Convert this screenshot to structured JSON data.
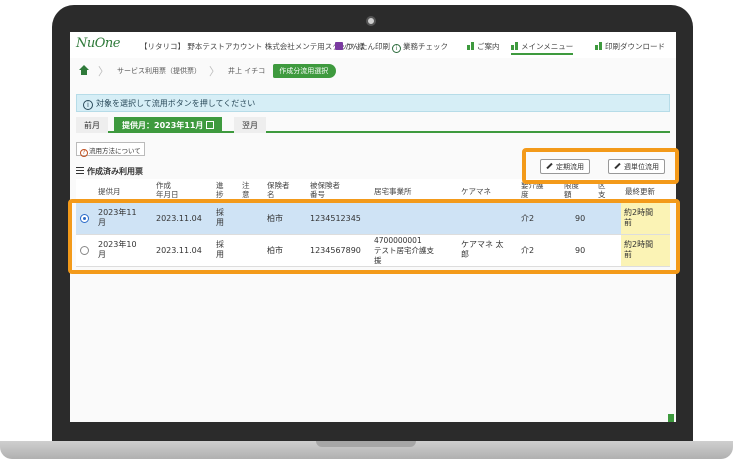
{
  "app": {
    "logo_text": "NuOne",
    "user_info": "【リタリコ】 野本テストアカウント 株式会社メンテ用スタッフ 様",
    "header_links": {
      "print": "かんたん印刷",
      "check": "業務チェック",
      "guide": "ご案内",
      "main_menu": "メインメニュー",
      "download": "印刷ダウンロード"
    }
  },
  "breadcrumb": {
    "item1": "サービス利用票（提供票）",
    "item2": "井上 イチコ",
    "current": "作成分流用選択"
  },
  "info_message": "対象を選択して流用ボタンを押してください",
  "month_tabs": {
    "prev": "前月",
    "current": "提供月：2023年11月",
    "next": "翌月"
  },
  "howto_link": "流用方法について",
  "section_title": "作成済み利用票",
  "buttons": {
    "periodic": "定期流用",
    "weekly": "週単位流用"
  },
  "table": {
    "headers": {
      "month": "提供月",
      "created": "作成\n年月日",
      "progress": "進\n捗",
      "note": "注\n意",
      "insurer": "保険者\n名",
      "insured_no": "被保険者\n番号",
      "office": "居宅事業所",
      "care_manager": "ケアマネ",
      "care_level": "要介護\n度",
      "limit": "限度\n額",
      "col_k": "区\n支",
      "updated": "最終更新"
    },
    "rows": [
      {
        "selected": true,
        "month": "2023年11\n月",
        "created": "2023.11.04",
        "progress": "採\n用",
        "insurer": "柏市",
        "insured_no": "1234512345",
        "office": "",
        "care_manager": "",
        "care_level": "介2",
        "limit": "90",
        "updated": "約2時間\n前"
      },
      {
        "selected": false,
        "month": "2023年10\n月",
        "created": "2023.11.04",
        "progress": "採\n用",
        "insurer": "柏市",
        "insured_no": "1234567890",
        "office": "4700000001\nテスト居宅介護支\n援",
        "care_manager": "ケアマネ 太\n郎",
        "care_level": "介2",
        "limit": "90",
        "updated": "約2時間\n前"
      }
    ]
  }
}
